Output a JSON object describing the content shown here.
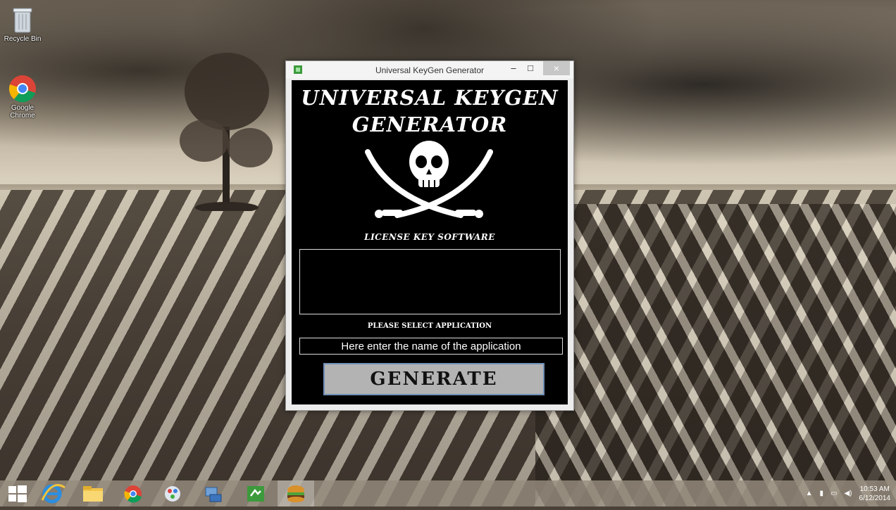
{
  "desktop": {
    "icons": [
      {
        "label": "Recycle Bin"
      },
      {
        "label": "Google Chrome"
      }
    ]
  },
  "window": {
    "title": "Universal KeyGen Generator",
    "controls": {
      "minimize": "–",
      "maximize": "□",
      "close": "×"
    }
  },
  "app": {
    "title_line1": "UNIVERSAL KEYGEN",
    "title_line2": "GENERATOR",
    "tagline": "LICENSE KEY SOFTWARE",
    "output_value": "",
    "select_label": "PLEASE SELECT APPLICATION",
    "app_name_placeholder": "Here enter the name of the application",
    "generate_label": "GENERATE"
  },
  "taskbar": {
    "items": [
      "start",
      "internet-explorer",
      "file-explorer",
      "chrome",
      "paint",
      "network",
      "keygen-app",
      "burger-app"
    ],
    "active_item": "burger-app",
    "clock_time": "10:53 AM",
    "clock_date": "6/12/2014"
  },
  "colors": {
    "window_bg": "#ececec",
    "client_bg": "#000000",
    "button_bg": "#b3b3b3",
    "button_border": "#6e8fb8"
  }
}
